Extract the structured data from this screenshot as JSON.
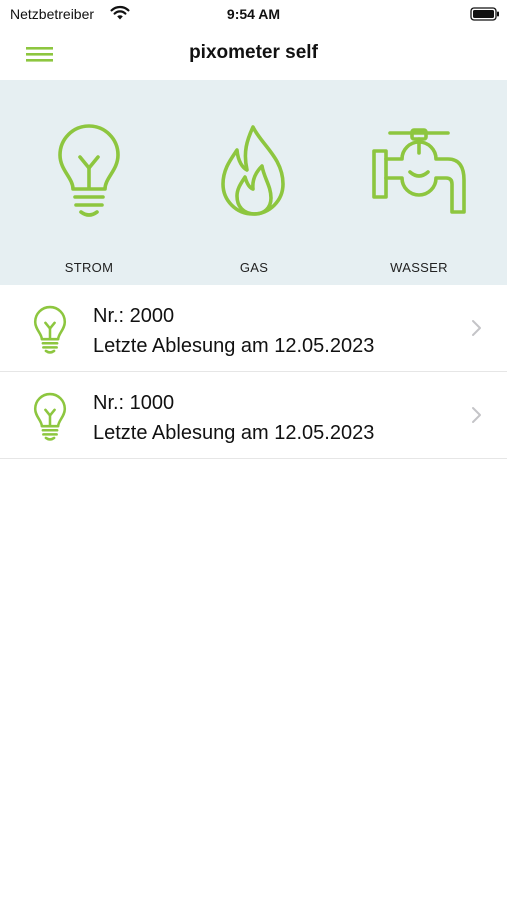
{
  "status": {
    "carrier": "Netzbetreiber",
    "time": "9:54 AM",
    "icons": [
      "wifi-icon",
      "battery-icon"
    ]
  },
  "header": {
    "title": "pixometer self",
    "menu_icon": "hamburger-menu-icon"
  },
  "categories": [
    {
      "label": "STROM",
      "icon": "lightbulb-icon"
    },
    {
      "label": "GAS",
      "icon": "flame-icon"
    },
    {
      "label": "WASSER",
      "icon": "water-tap-icon"
    }
  ],
  "meters": [
    {
      "number": "Nr.: 2000",
      "last_reading": "Letzte Ablesung am 12.05.2023",
      "icon": "lightbulb-icon"
    },
    {
      "number": "Nr.: 1000",
      "last_reading": "Letzte Ablesung am 12.05.2023",
      "icon": "lightbulb-icon"
    }
  ],
  "colors": {
    "accent": "#8dc63f",
    "category_background": "#e6eff2",
    "chevron": "#c4c4c7"
  }
}
